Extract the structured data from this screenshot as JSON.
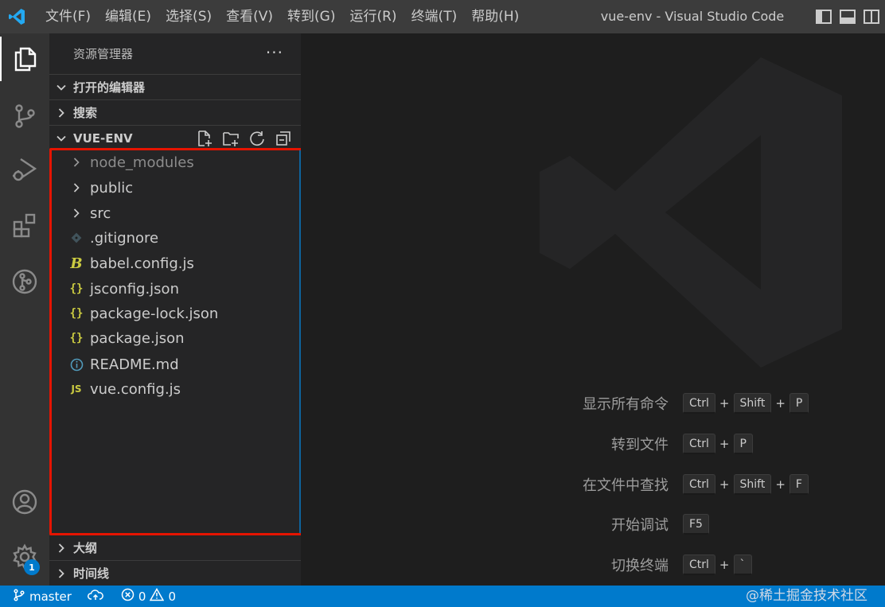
{
  "titlebar": {
    "menu": [
      {
        "id": "file",
        "label": "文件(F)"
      },
      {
        "id": "edit",
        "label": "编辑(E)"
      },
      {
        "id": "selection",
        "label": "选择(S)"
      },
      {
        "id": "view",
        "label": "查看(V)"
      },
      {
        "id": "go",
        "label": "转到(G)"
      },
      {
        "id": "run",
        "label": "运行(R)"
      },
      {
        "id": "terminal",
        "label": "终端(T)"
      },
      {
        "id": "help",
        "label": "帮助(H)"
      }
    ],
    "window_title": "vue-env - Visual Studio Code",
    "icons": [
      "vscode-logo-icon",
      "toggle-sidebar-icon",
      "toggle-panel-icon",
      "customize-layout-icon"
    ]
  },
  "activitybar": {
    "items": [
      "explorer-icon",
      "source-control-icon",
      "run-debug-icon",
      "extensions-icon",
      "git-graph-icon"
    ],
    "bottom": [
      "accounts-icon",
      "manage-gear-icon"
    ],
    "settings_badge": "1"
  },
  "sidebar": {
    "title": "资源管理器",
    "more": "···",
    "sections": {
      "open_editors": "打开的编辑器",
      "search": "搜索",
      "workspace": "VUE-ENV",
      "outline": "大纲",
      "timeline": "时间线"
    },
    "workspace_actions": [
      "new-file-icon",
      "new-folder-icon",
      "refresh-icon",
      "collapse-all-icon"
    ],
    "tree": [
      {
        "label": "node_modules",
        "kind": "folder",
        "icon": "chevron-right-icon",
        "dim": true
      },
      {
        "label": "public",
        "kind": "folder",
        "icon": "chevron-right-icon"
      },
      {
        "label": "src",
        "kind": "folder",
        "icon": "chevron-right-icon"
      },
      {
        "label": ".gitignore",
        "kind": "file",
        "icon": "git-file-icon"
      },
      {
        "label": "babel.config.js",
        "kind": "file",
        "icon": "babel-file-icon"
      },
      {
        "label": "jsconfig.json",
        "kind": "file",
        "icon": "json-file-icon"
      },
      {
        "label": "package-lock.json",
        "kind": "file",
        "icon": "json-file-icon"
      },
      {
        "label": "package.json",
        "kind": "file",
        "icon": "json-file-icon"
      },
      {
        "label": "README.md",
        "kind": "file",
        "icon": "info-file-icon"
      },
      {
        "label": "vue.config.js",
        "kind": "file",
        "icon": "js-file-icon"
      }
    ]
  },
  "editor": {
    "shortcuts": [
      {
        "label": "显示所有命令",
        "keys": [
          "Ctrl",
          "Shift",
          "P"
        ]
      },
      {
        "label": "转到文件",
        "keys": [
          "Ctrl",
          "P"
        ]
      },
      {
        "label": "在文件中查找",
        "keys": [
          "Ctrl",
          "Shift",
          "F"
        ]
      },
      {
        "label": "开始调试",
        "keys": [
          "F5"
        ]
      },
      {
        "label": "切换终端",
        "keys": [
          "Ctrl",
          "`"
        ]
      }
    ]
  },
  "statusbar": {
    "branch": "master",
    "errors": "0",
    "warnings": "0",
    "watermark": "@稀土掘金技术社区"
  },
  "colors": {
    "accent": "#007acc",
    "highlight_border": "#e51400",
    "json_icon": "#cbcb41",
    "js_icon": "#cbcb41",
    "info_icon": "#519aba"
  }
}
